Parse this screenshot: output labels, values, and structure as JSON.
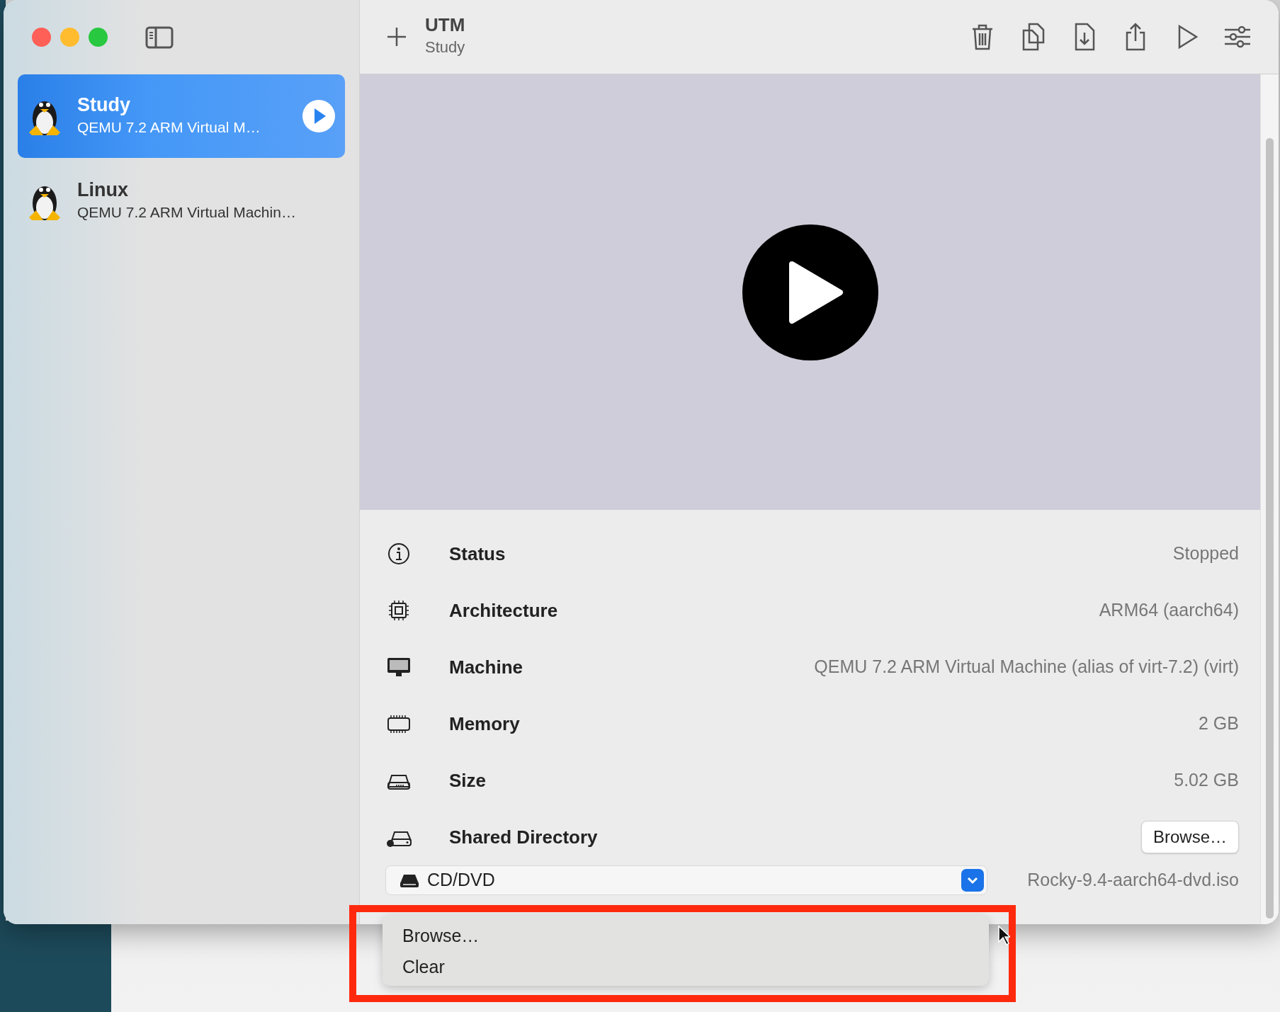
{
  "toolbar": {
    "title": "UTM",
    "subtitle": "Study"
  },
  "sidebar": {
    "items": [
      {
        "name": "Study",
        "subtitle": "QEMU 7.2 ARM Virtual M…",
        "selected": true
      },
      {
        "name": "Linux",
        "subtitle": "QEMU 7.2 ARM Virtual Machin…",
        "selected": false
      }
    ]
  },
  "details": [
    {
      "kind": "info",
      "label": "Status",
      "value": "Stopped"
    },
    {
      "kind": "chip",
      "label": "Architecture",
      "value": "ARM64 (aarch64)"
    },
    {
      "kind": "monitor",
      "label": "Machine",
      "value": "QEMU 7.2 ARM Virtual Machine (alias of virt-7.2) (virt)"
    },
    {
      "kind": "memory",
      "label": "Memory",
      "value": "2 GB"
    },
    {
      "kind": "disk",
      "label": "Size",
      "value": "5.02 GB"
    },
    {
      "kind": "shared",
      "label": "Shared Directory",
      "button": "Browse…"
    }
  ],
  "drive": {
    "label": "CD/DVD",
    "value": "Rocky-9.4-aarch64-dvd.iso"
  },
  "drive_menu": {
    "items": [
      "Browse…",
      "Clear"
    ]
  }
}
